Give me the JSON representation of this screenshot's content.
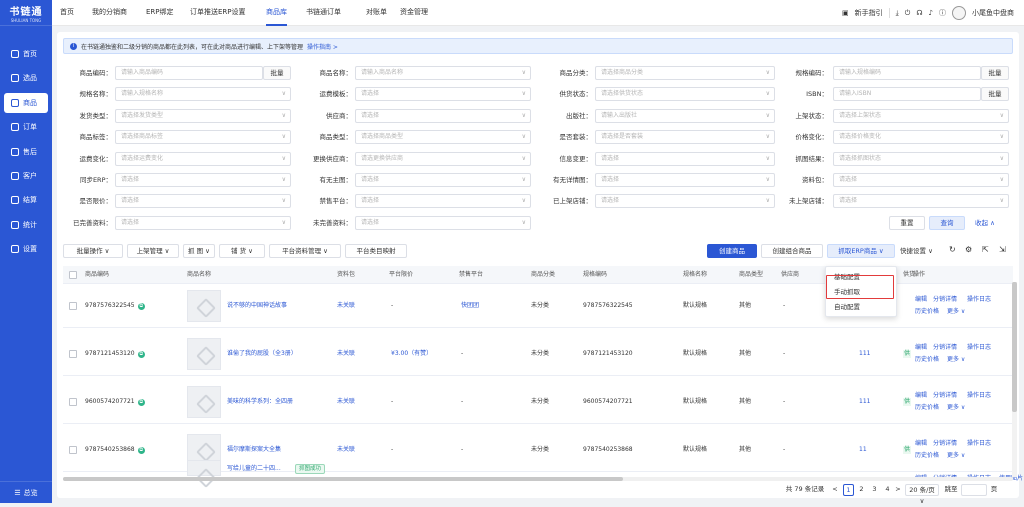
{
  "sidebar": {
    "logo": "书链通",
    "logo_sub": "SHULIAN TONG",
    "items": [
      {
        "label": "首页",
        "icon": "home-icon"
      },
      {
        "label": "选品",
        "icon": "select-icon"
      },
      {
        "label": "商品",
        "icon": "goods-icon"
      },
      {
        "label": "订单",
        "icon": "order-icon"
      },
      {
        "label": "售后",
        "icon": "aftersale-icon"
      },
      {
        "label": "客户",
        "icon": "customer-icon"
      },
      {
        "label": "结算",
        "icon": "settle-icon"
      },
      {
        "label": "统计",
        "icon": "stats-icon"
      },
      {
        "label": "设置",
        "icon": "settings-icon"
      }
    ],
    "active": "商品",
    "collapse": "总览"
  },
  "topbar": {
    "tabs": [
      "首页",
      "我的分销商",
      "ERP绑定",
      "订单推送ERP设置",
      "商品库",
      "书链通订单",
      "对账单",
      "资金管理"
    ],
    "active": "商品库",
    "guide": "新手指引",
    "shop": "小尾鱼中盘商"
  },
  "tip": {
    "text": "在书链通独鉴和二级分销的商品都在此列表，可在此对商品进行编辑、上下架等管理",
    "link": "操作指南 >"
  },
  "filters": [
    {
      "label": "商品编码：",
      "placeholder": "请输入商品编码",
      "btn": "批量"
    },
    {
      "label": "商品名称：",
      "placeholder": "请输入商品名称"
    },
    {
      "label": "商品分类：",
      "placeholder": "请选择商品分类"
    },
    {
      "label": "规格编码：",
      "placeholder": "请输入规格编码",
      "btn": "批量"
    },
    {
      "label": "规格名称：",
      "placeholder": "请输入规格名称"
    },
    {
      "label": "运费模板：",
      "placeholder": "请选择"
    },
    {
      "label": "供货状态：",
      "placeholder": "请选择供货状态"
    },
    {
      "label": "ISBN：",
      "placeholder": "请输入ISBN",
      "btn": "批量"
    },
    {
      "label": "发货类型：",
      "placeholder": "请选择发货类型"
    },
    {
      "label": "供应商：",
      "placeholder": "请选择"
    },
    {
      "label": "出版社：",
      "placeholder": "请输入出版社"
    },
    {
      "label": "上架状态：",
      "placeholder": "请选择上架状态"
    },
    {
      "label": "商品标签：",
      "placeholder": "请选择商品标签"
    },
    {
      "label": "商品类型：",
      "placeholder": "请选择商品类型"
    },
    {
      "label": "是否套装：",
      "placeholder": "请选择是否套装"
    },
    {
      "label": "价格变化：",
      "placeholder": "请选择价格变化"
    },
    {
      "label": "运费变化：",
      "placeholder": "请选择运费变化"
    },
    {
      "label": "更换供应商：",
      "placeholder": "请选更换供应商"
    },
    {
      "label": "信息变更：",
      "placeholder": "请选择"
    },
    {
      "label": "抓图结果：",
      "placeholder": "请选择抓图状态"
    },
    {
      "label": "同步ERP：",
      "placeholder": "请选择"
    },
    {
      "label": "有无主图：",
      "placeholder": "请选择"
    },
    {
      "label": "有无详情图：",
      "placeholder": "请选择"
    },
    {
      "label": "资料包：",
      "placeholder": "请选择"
    },
    {
      "label": "是否限价：",
      "placeholder": "请选择"
    },
    {
      "label": "禁售平台：",
      "placeholder": "请选择"
    },
    {
      "label": "已上架店铺：",
      "placeholder": "请选择"
    },
    {
      "label": "未上架店铺：",
      "placeholder": "请选择"
    },
    {
      "label": "已完善资料：",
      "placeholder": "请选择"
    },
    {
      "label": "未完善资料：",
      "placeholder": "请选择"
    }
  ],
  "filter_actions": {
    "reset": "重置",
    "search": "查询",
    "collapse": "收起 ∧"
  },
  "toolbar": {
    "left": [
      "批量操作 ∨",
      "上架管理 ∨",
      "抓 图 ∨",
      "铺 货 ∨",
      "平台资料管理 ∨",
      "平台类目映射"
    ],
    "create": "创建商品",
    "create_combo": "创建组合商品",
    "fetch_erp": "抓取ERP商品 ∨",
    "quick": "快捷设置 ∨"
  },
  "dropdown": [
    "基础配置",
    "手动抓取",
    "自动配置"
  ],
  "table": {
    "headers": [
      "商品编码",
      "商品名称",
      "资料包",
      "平台限价",
      "禁售平台",
      "商品分类",
      "规格编码",
      "规格名称",
      "商品类型",
      "供应商",
      "",
      "供货",
      "操作"
    ],
    "rows": [
      {
        "code": "9787576322545",
        "name": "说不够的中国神话故事",
        "pkg": "未关联",
        "limit": "-",
        "ban": "快团团",
        "cat": "未分类",
        "spec": "9787576322545",
        "spec_name": "默认规格",
        "type": "其他",
        "sup": "-",
        "stock": "",
        "supply": "",
        "ops": [
          "编辑",
          "分销详情",
          "操作日志",
          "历史价格",
          "更多 ∨"
        ]
      },
      {
        "code": "9787121453120",
        "name": "谁偷了我的屁股（全3册）",
        "pkg": "未关联",
        "limit": "¥3.00（有赞）",
        "ban": "-",
        "cat": "未分类",
        "spec": "9787121453120",
        "spec_name": "默认规格",
        "type": "其他",
        "sup": "-",
        "stock": "111",
        "supply": "供",
        "ops": [
          "编辑",
          "分销详情",
          "操作日志",
          "历史价格",
          "更多 ∨"
        ]
      },
      {
        "code": "9600574207721",
        "name": "美味的科学系列：全四册",
        "pkg": "未关联",
        "limit": "-",
        "ban": "-",
        "cat": "未分类",
        "spec": "9600574207721",
        "spec_name": "默认规格",
        "type": "其他",
        "sup": "-",
        "stock": "111",
        "supply": "供",
        "ops": [
          "编辑",
          "分销详情",
          "操作日志",
          "历史价格",
          "更多 ∨"
        ]
      },
      {
        "code": "9787540253868",
        "name": "福尔摩斯探案大全集",
        "pkg": "未关联",
        "limit": "-",
        "ban": "-",
        "cat": "未分类",
        "spec": "9787540253868",
        "spec_name": "默认规格",
        "type": "其他",
        "sup": "-",
        "stock": "11",
        "supply": "供",
        "ops": [
          "编辑",
          "分销详情",
          "操作日志",
          "历史价格",
          "更多 ∨"
        ]
      }
    ],
    "partial": {
      "name": "写给儿童的二十四...",
      "tag": "抓图成功",
      "ops": [
        "编辑",
        "分销详情",
        "操作日志",
        "使用图片"
      ]
    }
  },
  "pager": {
    "total": "共 79 条记录",
    "pages": [
      "1",
      "2",
      "3",
      "4"
    ],
    "current": "1",
    "size": "20 条/页 ∨",
    "goto": "跳至",
    "unit": "页"
  }
}
